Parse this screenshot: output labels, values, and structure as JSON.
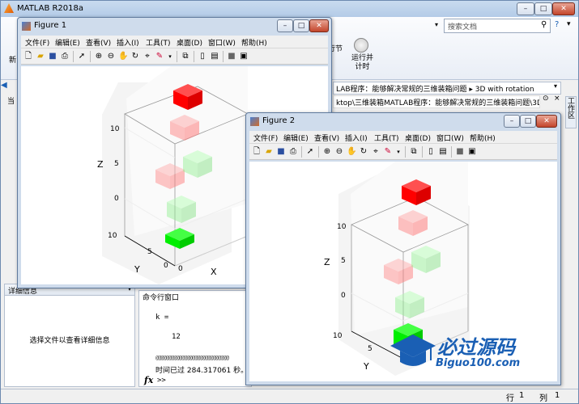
{
  "main": {
    "title": "MATLAB R2018a",
    "search_placeholder": "搜索文档",
    "ribbon": {
      "new_label": "新",
      "run_section_label": "行节",
      "run_time_label": "运行并\n计时"
    },
    "address": {
      "line1": "LAB程序：能够解决常规的三维装箱问题 ▸ 3D with rotation",
      "line2": "ktop\\三维装箱MATLAB程序：能够解决常规的三维装箱问题\\3D wit..."
    },
    "left_tab": "当",
    "workspace_tab": "工作区",
    "details": {
      "header": "详细信息",
      "message": "选择文件以查看详细信息"
    },
    "command_window": {
      "header": "命令行窗口",
      "line1": "k =",
      "line2": "12",
      "progress": "@@@@@@@@@@@@@@@@@@@@@@@@@@@@",
      "elapsed": "时间已过 284.317061 秒。",
      "prompt_symbol": "fx",
      "prompt": ">>"
    },
    "status": {
      "row_label": "行",
      "row_value": "1",
      "col_label": "列",
      "col_value": "1"
    }
  },
  "figure1": {
    "title": "Figure 1",
    "menu": [
      "文件(F)",
      "编辑(E)",
      "查看(V)",
      "插入(I)",
      "工具(T)",
      "桌面(D)",
      "窗口(W)",
      "帮助(H)"
    ],
    "axes": {
      "zlabel": "Z",
      "xlabel": "X",
      "ylabel": "Y",
      "z_ticks": [
        "10",
        "5",
        "0"
      ],
      "y_ticks": [
        "10",
        "5",
        "0"
      ],
      "x_ticks": [
        "0"
      ]
    }
  },
  "figure2": {
    "title": "Figure 2",
    "menu": [
      "文件(F)",
      "编辑(E)",
      "查看(V)",
      "插入(I)",
      "工具(T)",
      "桌面(D)",
      "窗口(W)",
      "帮助(H)"
    ],
    "axes": {
      "zlabel": "Z",
      "ylabel": "Y",
      "z_ticks": [
        "10",
        "5",
        "0"
      ],
      "y_ticks": [
        "10",
        "5"
      ]
    }
  },
  "watermark": {
    "title": "必过源码",
    "url": "Biguo100.com"
  },
  "colors": {
    "red": "#ff0000",
    "light_red": "#ffc8c8",
    "green": "#00ee00",
    "light_green": "#c8ffc8",
    "brand": "#1a5fb4"
  }
}
